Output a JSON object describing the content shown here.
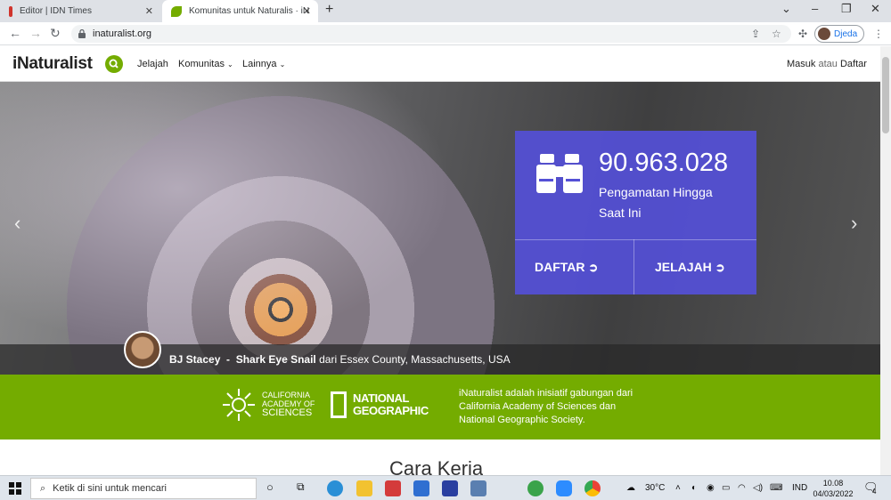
{
  "browser": {
    "tabs": [
      {
        "title": "Editor | IDN Times",
        "active": false
      },
      {
        "title": "Komunitas untuk Naturalis · iNat",
        "active": true
      }
    ],
    "url": "inaturalist.org",
    "profile_name": "Djeda"
  },
  "site": {
    "logo": "iNaturalist",
    "nav": [
      "Jelajah",
      "Komunitas",
      "Lainnya"
    ],
    "login": "Masuk",
    "login_connector": "atau",
    "signup": "Daftar"
  },
  "hero": {
    "stat_number": "90.963.028",
    "stat_label": "Pengamatan Hingga Saat Ini",
    "button_signup": "DAFTAR",
    "button_explore": "JELAJAH",
    "caption_user": "BJ Stacey",
    "caption_separator": "-",
    "caption_species": "Shark Eye Snail",
    "caption_place": "dari Essex County, Massachusetts, USA"
  },
  "partners": {
    "cas_line1": "CALIFORNIA",
    "cas_line2": "ACADEMY OF",
    "cas_line3": "SCIENCES",
    "natgeo_line1": "NATIONAL",
    "natgeo_line2": "GEOGRAPHIC",
    "description": "iNaturalist adalah inisiatif gabungan dari California Academy of Sciences dan National Geographic Society."
  },
  "section_title": "Cara Kerja",
  "taskbar": {
    "search_placeholder": "Ketik di sini untuk mencari",
    "weather": "30°C",
    "language": "IND",
    "time": "10.08",
    "date": "04/03/2022",
    "notification_count": "4"
  },
  "colors": {
    "brand_green": "#74ac00",
    "stats_purple": "#5450d6"
  }
}
